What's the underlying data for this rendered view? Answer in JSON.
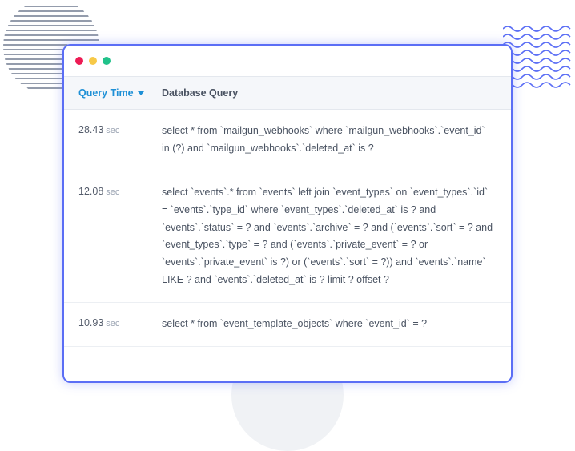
{
  "headers": {
    "time": "Query Time",
    "query": "Database Query"
  },
  "time_unit": "sec",
  "rows": [
    {
      "time": "28.43",
      "query": "select * from `mailgun_webhooks` where `mailgun_webhooks`.`event_id` in (?) and `mailgun_webhooks`.`deleted_at` is ?"
    },
    {
      "time": "12.08",
      "query": "select `events`.* from `events` left join `event_types` on `event_types`.`id` = `events`.`type_id` where `event_types`.`deleted_at` is ? and `events`.`status` = ? and `events`.`archive` = ? and (`events`.`sort` = ? and `event_types`.`type` = ? and (`events`.`private_event` = ? or `events`.`private_event` is ?) or (`events`.`sort` = ?)) and `events`.`name` LIKE ? and `events`.`deleted_at` is ? limit ? offset ?"
    },
    {
      "time": "10.93",
      "query": "select * from `event_template_objects` where `event_id` = ?"
    }
  ]
}
